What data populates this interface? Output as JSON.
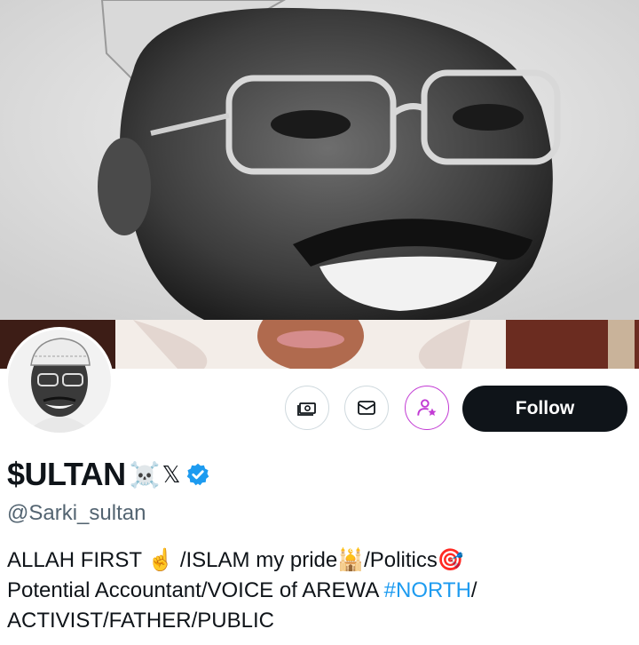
{
  "profile": {
    "display_name": "$ULTAN",
    "name_emoji": "☠️",
    "x_glyph": "𝕏",
    "handle": "@Sarki_sultan",
    "verified": true,
    "accent": "#1d9bf0"
  },
  "actions": {
    "follow_label": "Follow",
    "tip_icon": "money-icon",
    "message_icon": "mail-icon",
    "subscribe_icon": "subscribe-star-icon",
    "subscribe_color": "#c23bd4"
  },
  "bio": {
    "line1_a": "ALLAH FIRST ",
    "line1_emoji1": "☝️",
    "line1_b": " /ISLAM my pride",
    "line1_emoji2": "🕌",
    "line1_c": "/Politics",
    "line1_emoji3": "🎯",
    "line2_a": "Potential Accountant/VOICE of AREWA ",
    "line2_hashtag": "#NORTH",
    "line2_b": "/",
    "line3": "ACTIVIST/FATHER/PUBLIC"
  }
}
